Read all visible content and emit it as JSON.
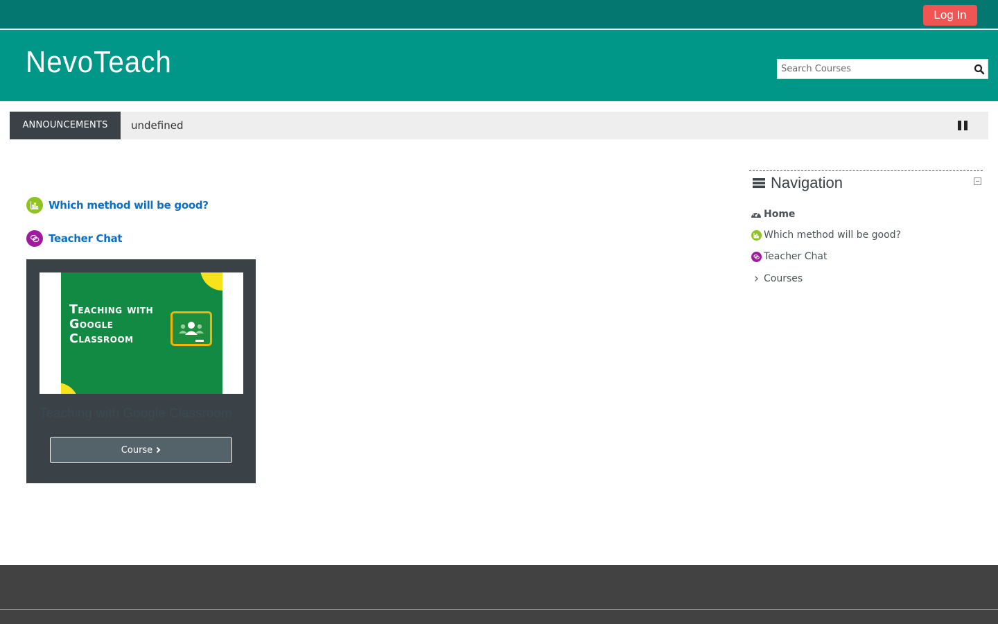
{
  "topbar": {
    "login_label": "Log In",
    "login_color": "#f05453"
  },
  "header": {
    "site_title": "NevoTeach",
    "search_placeholder": "Search Courses",
    "background": "#009688"
  },
  "announcements": {
    "label": "ANNOUNCEMENTS",
    "text": "undefined"
  },
  "activities": [
    {
      "label": "Which method will be good?",
      "icon": "chart-icon",
      "color": "#8fc31f"
    },
    {
      "label": "Teacher Chat",
      "icon": "chat-icon",
      "color": "#a0199f"
    }
  ],
  "course_card": {
    "image_text": "Teaching with Google Classroom",
    "name": "Teaching with Google Classroom",
    "button_label": "Course",
    "button_icon": "chevron-right-icon"
  },
  "navigation": {
    "title": "Navigation",
    "items": [
      {
        "label": "Home",
        "icon": "dashboard-icon"
      },
      {
        "label": "Which method will be good?",
        "icon": "chart-icon"
      },
      {
        "label": "Teacher Chat",
        "icon": "chat-icon"
      },
      {
        "label": "Courses",
        "icon": "chevron-right-icon"
      }
    ]
  }
}
